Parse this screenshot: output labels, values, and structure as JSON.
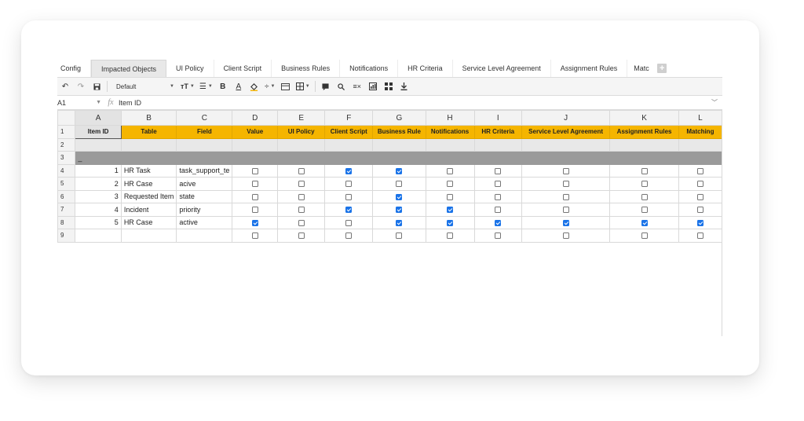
{
  "tabs": [
    "Config",
    "Impacted Objects",
    "UI Policy",
    "Client Script",
    "Business Rules",
    "Notifications",
    "HR Criteria",
    "Service Level Agreement",
    "Assignment Rules",
    "Matc"
  ],
  "active_tab": "Impacted Objects",
  "toolbar": {
    "font_name": "Default"
  },
  "formula_bar": {
    "cell_ref": "A1",
    "fx": "fx",
    "value": "Item ID"
  },
  "columns": [
    "A",
    "B",
    "C",
    "D",
    "E",
    "F",
    "G",
    "H",
    "I",
    "J",
    "K",
    "L"
  ],
  "rows": [
    {
      "n": "1",
      "kind": "header",
      "cells": [
        "Item ID",
        "Table",
        "Field",
        "Value",
        "UI Policy",
        "Client Script",
        "Business Rule",
        "Notifications",
        "HR Criteria",
        "Service Level Agreement",
        "Assignment Rules",
        "Matching"
      ]
    },
    {
      "n": "2",
      "kind": "blank"
    },
    {
      "n": "3",
      "kind": "grey",
      "cells": [
        "_"
      ]
    },
    {
      "n": "4",
      "id": "1",
      "table": "HR Task",
      "field": "task_support_te",
      "checks": [
        false,
        false,
        true,
        true,
        false,
        false,
        false,
        false,
        false
      ]
    },
    {
      "n": "5",
      "id": "2",
      "table": "HR Case",
      "field": "acive",
      "checks": [
        false,
        false,
        false,
        false,
        false,
        false,
        false,
        false,
        false
      ]
    },
    {
      "n": "6",
      "id": "3",
      "table": "Requested Item",
      "field": "state",
      "checks": [
        false,
        false,
        false,
        true,
        false,
        false,
        false,
        false,
        false
      ]
    },
    {
      "n": "7",
      "id": "4",
      "table": "Incident",
      "field": "priority",
      "checks": [
        false,
        false,
        true,
        true,
        true,
        false,
        false,
        false,
        false
      ]
    },
    {
      "n": "8",
      "id": "5",
      "table": "HR Case",
      "field": "active",
      "checks": [
        true,
        false,
        false,
        true,
        true,
        true,
        true,
        true,
        true
      ]
    },
    {
      "n": "9",
      "id": "",
      "table": "",
      "field": "",
      "checks": [
        false,
        false,
        false,
        false,
        false,
        false,
        false,
        false,
        false
      ]
    }
  ],
  "colors": {
    "header_fill": "#f5b500",
    "check_on": "#1a73e8",
    "grey_row": "#9a9a9a"
  }
}
